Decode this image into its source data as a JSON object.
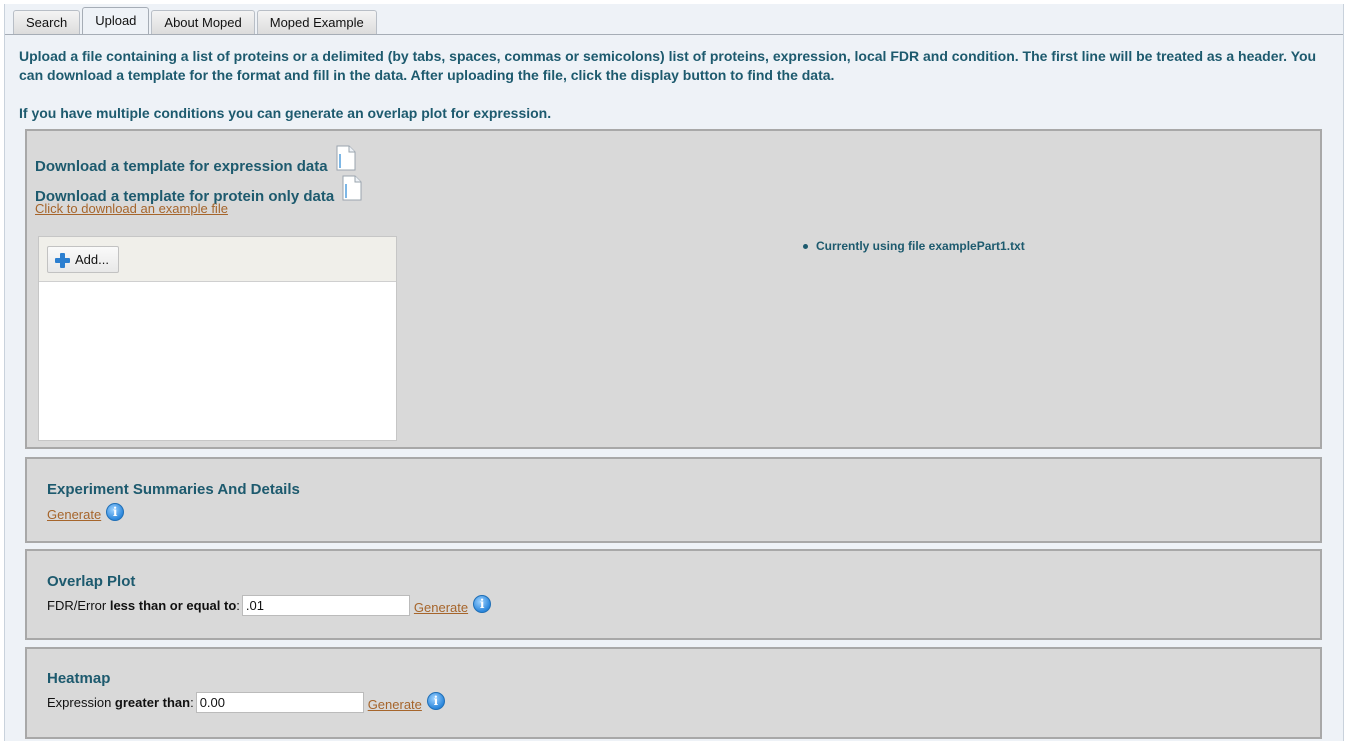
{
  "tabs": [
    {
      "label": "Search",
      "active": false
    },
    {
      "label": "Upload",
      "active": true
    },
    {
      "label": "About Moped",
      "active": false
    },
    {
      "label": "Moped Example",
      "active": false
    }
  ],
  "intro": {
    "paragraph1": "Upload a file containing a list of proteins or a delimited (by tabs, spaces, commas or semicolons) list of proteins, expression, local FDR and condition. The first line will be treated as a header. You can download a template for the format and fill in the data. After uploading the file, click the display button to find the data.",
    "paragraph2": "If you have multiple conditions you can generate an overlap plot for expression."
  },
  "upload_panel": {
    "template_expression": "Download a template for expression data",
    "template_protein": "Download a template for protein only data",
    "example_link": "Click to download an example file",
    "add_button": "Add...",
    "current_file": "Currently using file examplePart1.txt"
  },
  "summaries": {
    "title": "Experiment Summaries And Details",
    "generate": "Generate"
  },
  "overlap": {
    "title": "Overlap Plot",
    "label_prefix": "FDR/Error ",
    "label_bold": "less than or equal to",
    "label_suffix": ":",
    "value": ".01",
    "generate": "Generate"
  },
  "heatmap": {
    "title": "Heatmap",
    "label_prefix": "Expression ",
    "label_bold": "greater than",
    "label_suffix": ":",
    "value": "0.00",
    "generate": "Generate"
  },
  "icons": {
    "document": "document-icon",
    "add": "plus-icon",
    "info": "info-icon"
  },
  "colors": {
    "heading_text": "#1d5a6e",
    "link": "#a6652b",
    "panel_bg": "#d9d9d9",
    "page_bg": "#eef2f7"
  }
}
